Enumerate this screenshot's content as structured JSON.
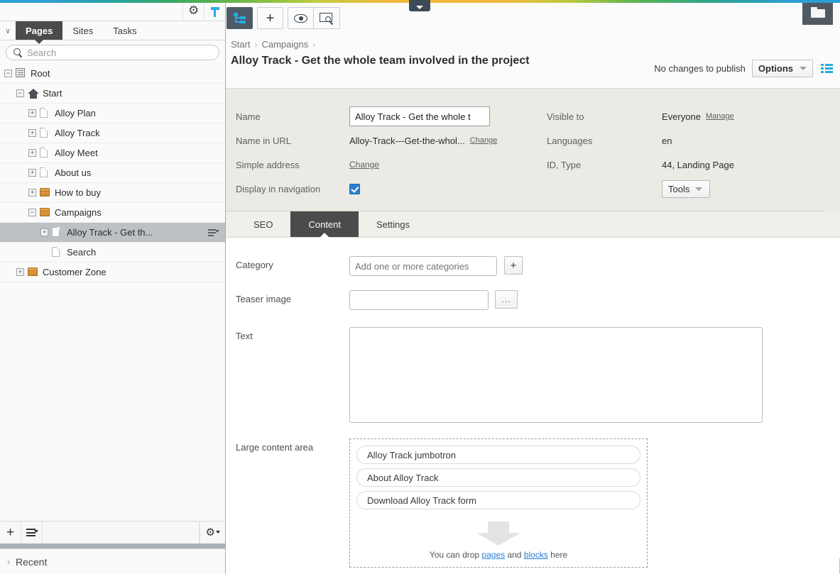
{
  "window": {
    "accent_blue": "#29abe2",
    "gradient_colors": [
      "#2b9fd4",
      "#26a39b",
      "#79bb48",
      "#f0b93c",
      "#58b254",
      "#2c9ed3"
    ]
  },
  "left_panel": {
    "top_icons": [
      {
        "name": "gear-icon",
        "label": "Settings"
      },
      {
        "name": "pin-icon",
        "label": "Pin"
      }
    ],
    "collapse_caret": "∨",
    "tabs": [
      {
        "label": "Pages",
        "active": true
      },
      {
        "label": "Sites",
        "active": false
      },
      {
        "label": "Tasks",
        "active": false
      }
    ],
    "search": {
      "placeholder": "Search",
      "value": ""
    },
    "tree": [
      {
        "label": "Root",
        "indent": 0,
        "toggle": "−",
        "icon": "root-icon",
        "selected": false,
        "context_menu": false
      },
      {
        "label": "Start",
        "indent": 1,
        "toggle": "−",
        "icon": "home-icon",
        "selected": false,
        "context_menu": false
      },
      {
        "label": "Alloy Plan",
        "indent": 2,
        "toggle": "+",
        "icon": "page-icon",
        "selected": false,
        "context_menu": false
      },
      {
        "label": "Alloy Track",
        "indent": 2,
        "toggle": "+",
        "icon": "page-icon",
        "selected": false,
        "context_menu": false
      },
      {
        "label": "Alloy Meet",
        "indent": 2,
        "toggle": "+",
        "icon": "page-icon",
        "selected": false,
        "context_menu": false
      },
      {
        "label": "About us",
        "indent": 2,
        "toggle": "+",
        "icon": "page-icon",
        "selected": false,
        "context_menu": false
      },
      {
        "label": "How to buy",
        "indent": 2,
        "toggle": "+",
        "icon": "folder-icon",
        "selected": false,
        "context_menu": false
      },
      {
        "label": "Campaigns",
        "indent": 2,
        "toggle": "−",
        "icon": "folder-icon",
        "selected": false,
        "context_menu": false
      },
      {
        "label": "Alloy Track - Get th...",
        "indent": 3,
        "toggle": "+",
        "icon": "page-icon",
        "selected": true,
        "context_menu": true
      },
      {
        "label": "Search",
        "indent": 3,
        "toggle": "",
        "icon": "page-icon",
        "selected": false,
        "context_menu": false
      },
      {
        "label": "Customer Zone",
        "indent": 1,
        "toggle": "+",
        "icon": "folder-icon",
        "selected": false,
        "context_menu": false
      }
    ],
    "bottom_toolbar": {
      "add_label": "+",
      "menu_name": "list-menu-icon",
      "settings_name": "gear-dropdown-icon"
    },
    "recent": {
      "label": "Recent",
      "chevron": "›"
    }
  },
  "main": {
    "toolbar": [
      {
        "name": "sitemap-icon",
        "active": true
      },
      {
        "name": "add-icon",
        "active": false
      },
      {
        "name": "preview-eye-icon",
        "active": false
      },
      {
        "name": "view-on-site-icon",
        "active": false
      }
    ],
    "folder_tab_icon": "folder-icon",
    "breadcrumb": [
      "Start",
      "Campaigns"
    ],
    "breadcrumb_separator": "›",
    "page_title": "Alloy Track - Get the whole team involved in the project",
    "publish_status": "No changes to publish",
    "options_button": "Options",
    "list_view_icon": "list-view-icon"
  },
  "info_panel": {
    "left": [
      {
        "label": "Name",
        "type": "input",
        "value": "Alloy Track - Get the whole t"
      },
      {
        "label": "Name in URL",
        "type": "text-link",
        "value": "Alloy-Track---Get-the-whol...",
        "link": "Change"
      },
      {
        "label": "Simple address",
        "type": "link-only",
        "value": "",
        "link": "Change"
      },
      {
        "label": "Display in navigation",
        "type": "checkbox",
        "checked": true
      }
    ],
    "right": [
      {
        "label": "Visible to",
        "value": "Everyone",
        "link": "Manage"
      },
      {
        "label": "Languages",
        "value": "en",
        "link": ""
      },
      {
        "label": "ID, Type",
        "value": "44, Landing Page",
        "link": ""
      }
    ],
    "tools_button": "Tools"
  },
  "content_tabs": [
    {
      "label": "SEO",
      "active": false
    },
    {
      "label": "Content",
      "active": true
    },
    {
      "label": "Settings",
      "active": false
    }
  ],
  "content_form": {
    "category": {
      "label": "Category",
      "placeholder": "Add one or more categories",
      "value": "",
      "add_button": "+"
    },
    "teaser_image": {
      "label": "Teaser image",
      "value": "",
      "browse_button": "..."
    },
    "text": {
      "label": "Text",
      "value": ""
    },
    "large_content_area": {
      "label": "Large content area",
      "blocks": [
        "Alloy Track jumbotron",
        "About Alloy Track",
        "Download Alloy Track form"
      ],
      "drop_prefix": "You can drop ",
      "drop_link1": "pages",
      "drop_middle": " and ",
      "drop_link2": "blocks",
      "drop_suffix": " here"
    }
  }
}
